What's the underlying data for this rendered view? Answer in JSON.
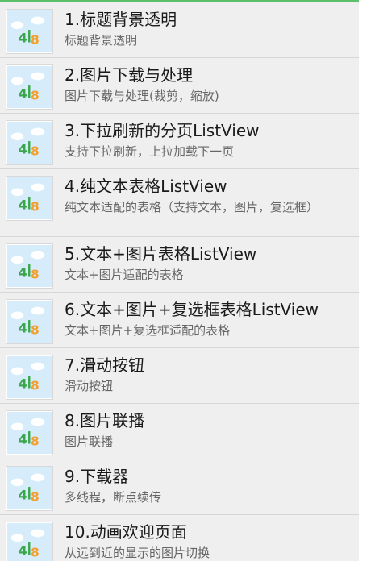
{
  "colors": {
    "accent_bar": "#5cc06a",
    "list_bg": "#efefef",
    "title": "#1a1a1a",
    "subtitle": "#666666"
  },
  "list": {
    "items": [
      {
        "icon": "app-logo-icon",
        "title": "1.标题背景透明",
        "subtitle": "标题背景透明"
      },
      {
        "icon": "app-logo-icon",
        "title": "2.图片下载与处理",
        "subtitle": "图片下载与处理(裁剪，缩放)"
      },
      {
        "icon": "app-logo-icon",
        "title": "3.下拉刷新的分页ListView",
        "subtitle": "支持下拉刷新，上拉加载下一页"
      },
      {
        "icon": "app-logo-icon",
        "title": "4.纯文本表格ListView",
        "subtitle": "纯文本适配的表格（支持文本，图片，复选框）"
      },
      {
        "icon": "app-logo-icon",
        "title": "5.文本+图片表格ListView",
        "subtitle": "文本+图片适配的表格"
      },
      {
        "icon": "app-logo-icon",
        "title": "6.文本+图片+复选框表格ListView",
        "subtitle": "文本+图片+复选框适配的表格"
      },
      {
        "icon": "app-logo-icon",
        "title": "7.滑动按钮",
        "subtitle": "滑动按钮"
      },
      {
        "icon": "app-logo-icon",
        "title": "8.图片联播",
        "subtitle": "图片联播"
      },
      {
        "icon": "app-logo-icon",
        "title": "9.下载器",
        "subtitle": "多线程，断点续传"
      },
      {
        "icon": "app-logo-icon",
        "title": "10.动画欢迎页面",
        "subtitle": "从远到近的显示的图片切换"
      }
    ]
  }
}
